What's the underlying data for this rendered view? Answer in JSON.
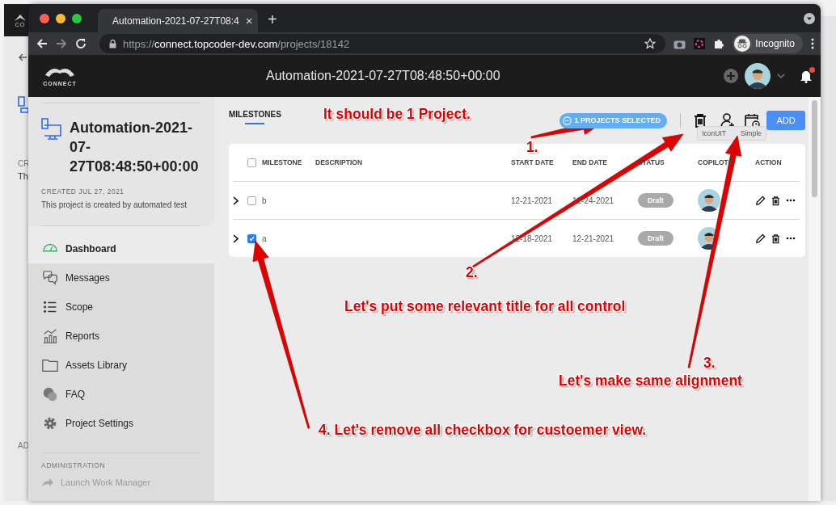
{
  "back_window": {
    "logo_text": "CO",
    "fragments": [
      "CR",
      "Th",
      "AD"
    ]
  },
  "browser": {
    "tab": {
      "title": "Automation-2021-07-27T08:4",
      "close": "×"
    },
    "new_tab": "+",
    "url": {
      "scheme": "https://",
      "host": "connect.topcoder-dev.com",
      "path": "/projects/18142"
    },
    "profile": "Incognito"
  },
  "header": {
    "logo_text": "CONNECT",
    "title": "Automation-2021-07-27T08:48:50+00:00",
    "notifications_unread": true
  },
  "sidebar": {
    "project_title": "Automation-2021-07-27T08:48:50+00:00",
    "created": "CREATED JUL 27, 2021",
    "description": "This project is created by automated test",
    "nav": [
      {
        "label": "Dashboard",
        "selected": true
      },
      {
        "label": "Messages",
        "selected": false
      },
      {
        "label": "Scope",
        "selected": false
      },
      {
        "label": "Reports",
        "selected": false
      },
      {
        "label": "Assets Library",
        "selected": false
      },
      {
        "label": "FAQ",
        "selected": false
      },
      {
        "label": "Project Settings",
        "selected": false
      }
    ],
    "admin_heading": "ADMINISTRATION",
    "admin_items": [
      {
        "label": "Launch Work Manager",
        "disabled": true
      }
    ]
  },
  "milestones": {
    "tabs": [
      {
        "label": "MILESTONES",
        "selected": true
      }
    ],
    "selection_badge": "1 PROJECTS SELECTED",
    "add_button": "ADD",
    "tooltip": [
      "IconUIT",
      "Simple"
    ],
    "table": {
      "columns": [
        "MILESTONE",
        "DESCRIPTION",
        "START DATE",
        "END DATE",
        "STATUS",
        "COPILOTS",
        "ACTION"
      ],
      "select_all": {
        "checked": false
      },
      "rows": [
        {
          "milestone": "b",
          "start_date": "12-21-2021",
          "end_date": "12-24-2021",
          "status": "Draft",
          "checked": false
        },
        {
          "milestone": "a",
          "start_date": "12-18-2021",
          "end_date": "12-21-2021",
          "status": "Draft",
          "checked": true
        }
      ]
    }
  },
  "annotations": [
    {
      "text": "It should be 1 Project."
    },
    {
      "text": "1."
    },
    {
      "text": "2."
    },
    {
      "text": "Let's put some relevant title for all control"
    },
    {
      "text": "3."
    },
    {
      "text": "Let's make same alignment"
    },
    {
      "text": "4. Let's remove all checkbox for custoemer view."
    }
  ]
}
